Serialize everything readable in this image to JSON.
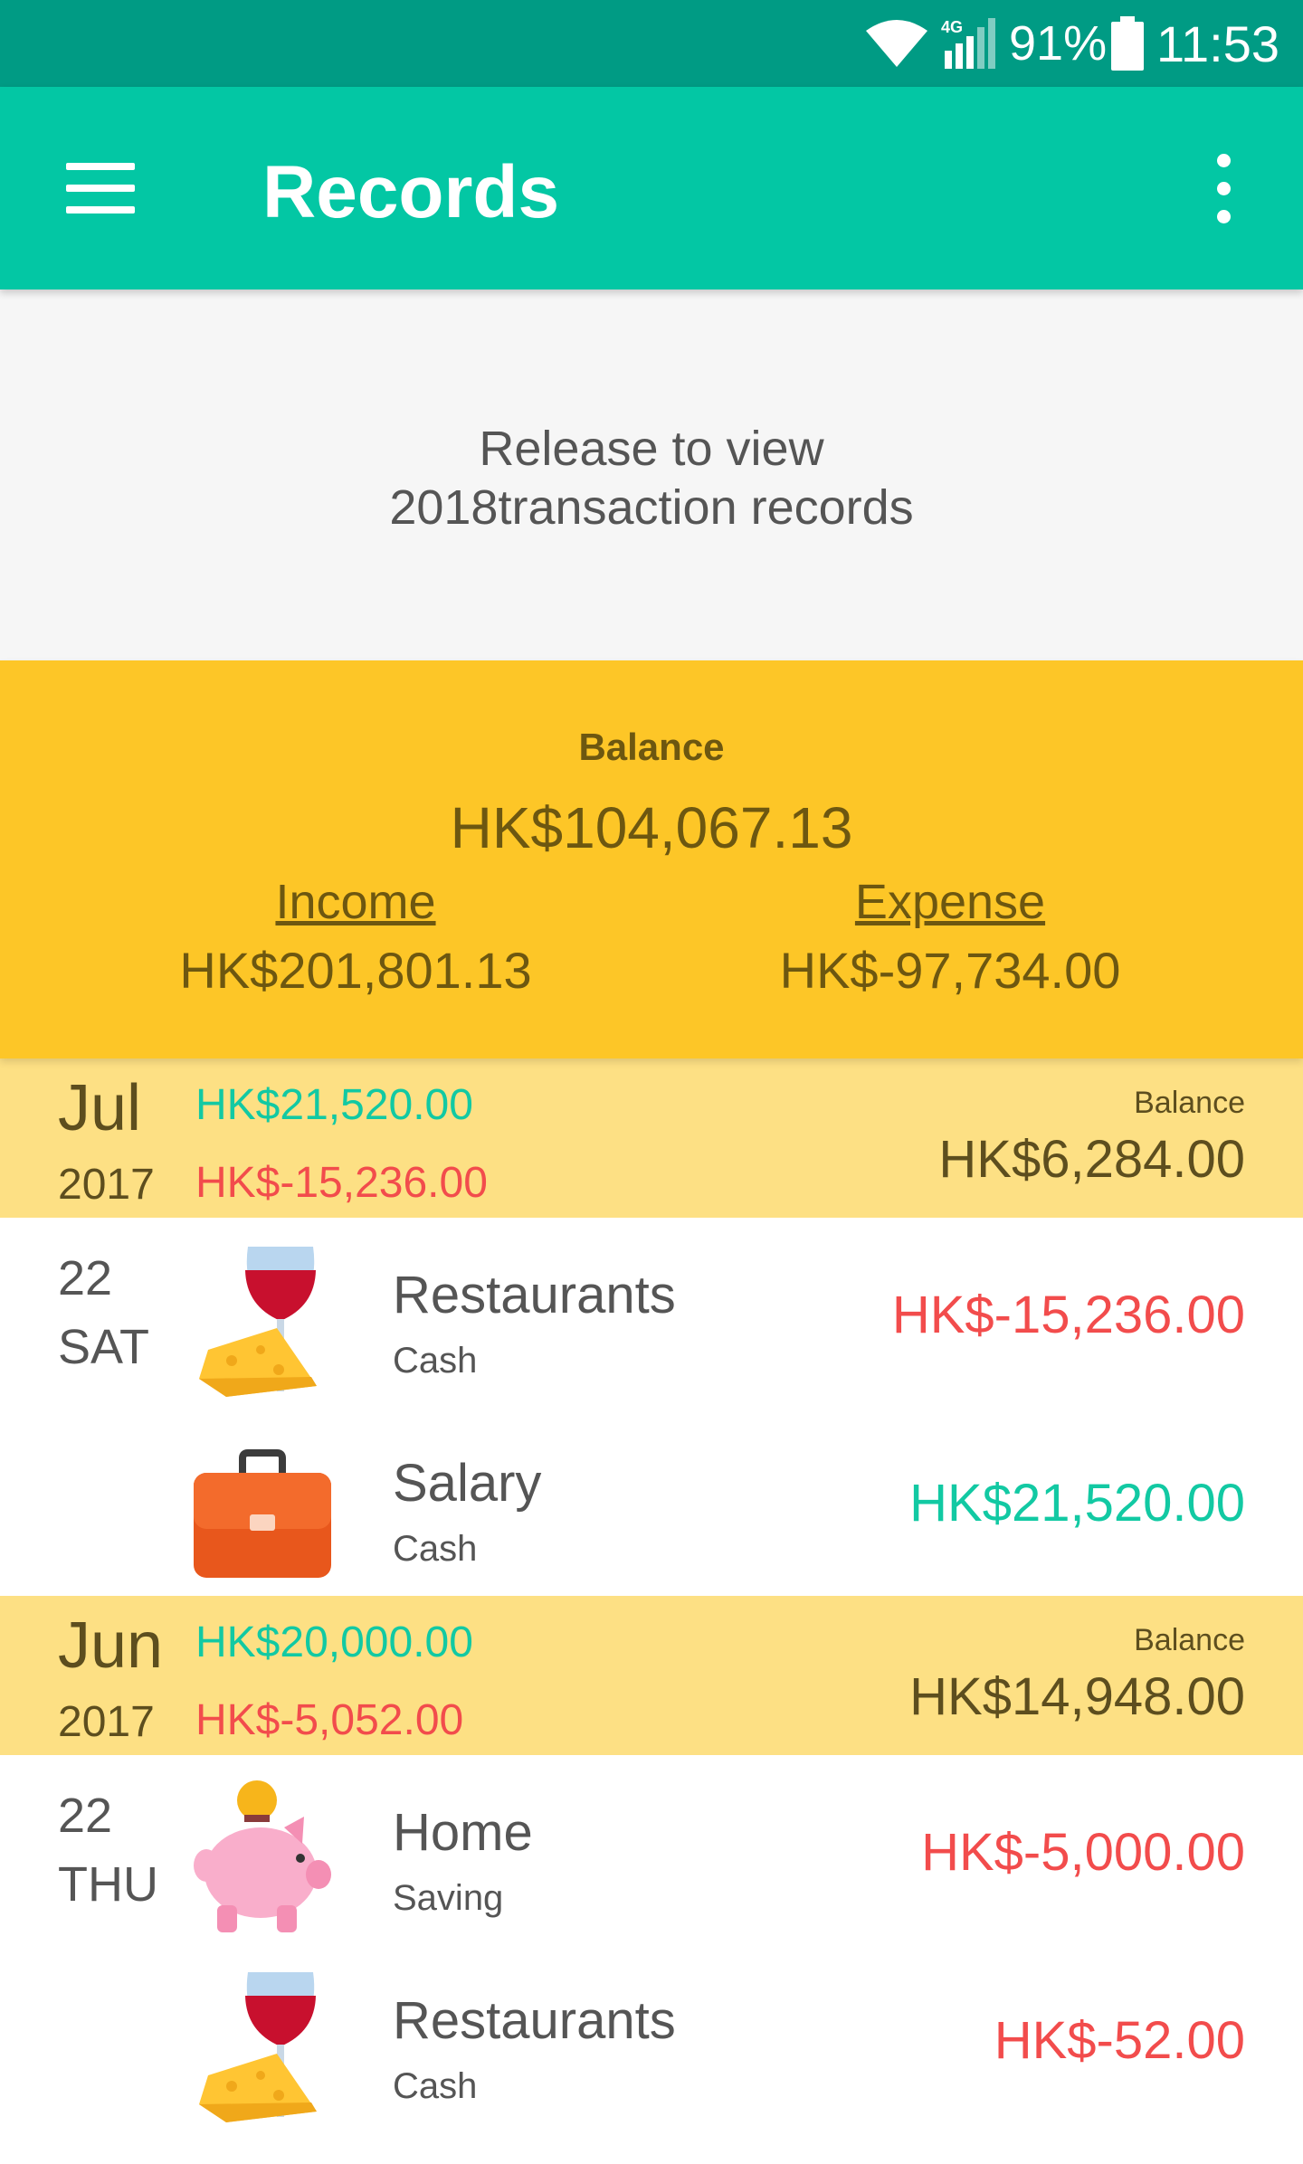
{
  "status_bar": {
    "network_label": "4G",
    "battery_percent": "91%",
    "time": "11:53",
    "icons": [
      "wifi-icon",
      "signal-icon",
      "battery-icon"
    ]
  },
  "app_bar": {
    "title": "Records",
    "menu_icon": "hamburger-menu-icon",
    "overflow_icon": "more-vert-icon"
  },
  "pull_hint": {
    "line1": "Release to view",
    "line2": "2018transaction records"
  },
  "summary": {
    "balance_label": "Balance",
    "balance_value": "HK$104,067.13",
    "income_label": "Income",
    "income_value": "HK$201,801.13",
    "expense_label": "Expense",
    "expense_value": "HK$-97,734.00"
  },
  "months": [
    {
      "month": "Jul",
      "year": "2017",
      "income": "HK$21,520.00",
      "expense": "HK$-15,236.00",
      "balance_label": "Balance",
      "balance_value": "HK$6,284.00",
      "transactions": [
        {
          "day": "22",
          "dow": "SAT",
          "category": "Restaurants",
          "account": "Cash",
          "amount": "HK$-15,236.00",
          "type": "expense",
          "icon": "wine-cheese-icon"
        },
        {
          "day": "",
          "dow": "",
          "category": "Salary",
          "account": "Cash",
          "amount": "HK$21,520.00",
          "type": "income",
          "icon": "briefcase-icon"
        }
      ]
    },
    {
      "month": "Jun",
      "year": "2017",
      "income": "HK$20,000.00",
      "expense": "HK$-5,052.00",
      "balance_label": "Balance",
      "balance_value": "HK$14,948.00",
      "transactions": [
        {
          "day": "22",
          "dow": "THU",
          "category": "Home",
          "account": "Saving",
          "amount": "HK$-5,000.00",
          "type": "expense",
          "icon": "piggy-bank-icon"
        },
        {
          "day": "",
          "dow": "",
          "category": "Restaurants",
          "account": "Cash",
          "amount": "HK$-52.00",
          "type": "expense",
          "icon": "wine-cheese-icon"
        }
      ]
    }
  ],
  "colors": {
    "status_bar": "#009b84",
    "app_bar": "#03c7a4",
    "summary_bg": "#fdc627",
    "month_header_bg": "#fde084",
    "income": "#12c9a3",
    "expense": "#f24c4c"
  }
}
